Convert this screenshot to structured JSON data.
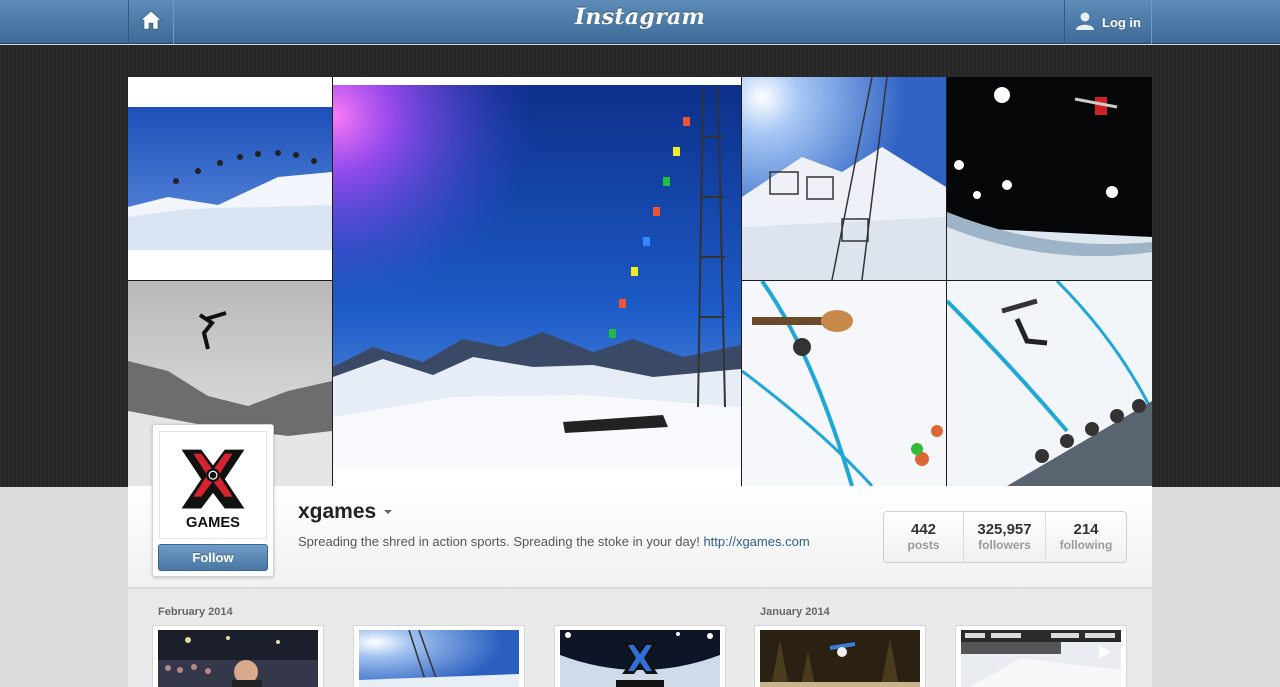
{
  "nav": {
    "brand": "Instagram",
    "login_label": "Log in",
    "home_icon": "home-icon",
    "user_icon": "user-icon"
  },
  "colors": {
    "nav_blue": "#4a77a4",
    "link_blue": "#2e5e8e",
    "follow_blue": "#5a87b4"
  },
  "profile": {
    "username": "xgames",
    "bio": "Spreading the shred in action sports. Spreading the stoke in your day!",
    "website": "http://xgames.com",
    "avatar_text": "GAMES",
    "follow_label": "Follow",
    "stats": [
      {
        "value": "442",
        "label": "posts"
      },
      {
        "value": "325,957",
        "label": "followers"
      },
      {
        "value": "214",
        "label": "following"
      }
    ]
  },
  "feed": {
    "months": [
      "February 2014",
      "January 2014"
    ],
    "thumbnails": [
      {
        "subject": "crowd-at-concert"
      },
      {
        "subject": "ski-lift-sun"
      },
      {
        "subject": "x-games-halfpipe"
      },
      {
        "subject": "snowboarder-night"
      },
      {
        "subject": "ski-race-video"
      }
    ]
  }
}
